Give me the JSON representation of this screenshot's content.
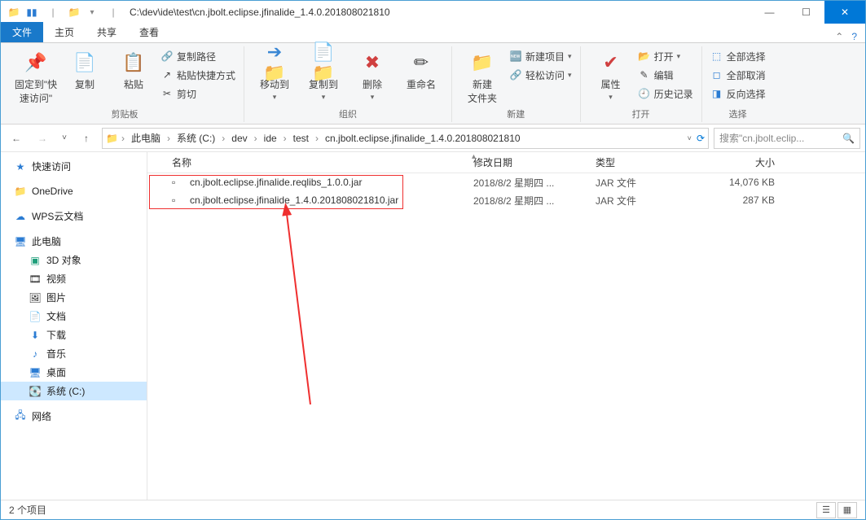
{
  "title_path": "C:\\dev\\ide\\test\\cn.jbolt.eclipse.jfinalide_1.4.0.201808021810",
  "tabs": {
    "file": "文件",
    "home": "主页",
    "share": "共享",
    "view": "查看"
  },
  "ribbon": {
    "pin": {
      "label": "固定到\"快\n速访问\""
    },
    "copy": {
      "label": "复制"
    },
    "paste": {
      "label": "粘贴"
    },
    "clipboard": {
      "copy_path": "复制路径",
      "paste_shortcut": "粘贴快捷方式",
      "cut": "剪切",
      "group": "剪贴板"
    },
    "org": {
      "move_to": "移动到",
      "copy_to": "复制到",
      "delete": "删除",
      "rename": "重命名",
      "group": "组织"
    },
    "new": {
      "new_folder": "新建\n文件夹",
      "new_item": "新建项目",
      "easy_access": "轻松访问",
      "group": "新建"
    },
    "open": {
      "properties": "属性",
      "open": "打开",
      "edit": "编辑",
      "history": "历史记录",
      "group": "打开"
    },
    "select": {
      "select_all": "全部选择",
      "select_none": "全部取消",
      "invert": "反向选择",
      "group": "选择"
    }
  },
  "breadcrumb": [
    "此电脑",
    "系统 (C:)",
    "dev",
    "ide",
    "test",
    "cn.jbolt.eclipse.jfinalide_1.4.0.201808021810"
  ],
  "search_placeholder": "搜索\"cn.jbolt.eclip...",
  "sidebar": {
    "quick": "快速访问",
    "onedrive": "OneDrive",
    "wps": "WPS云文档",
    "thispc": "此电脑",
    "items_pc": [
      "3D 对象",
      "视频",
      "图片",
      "文档",
      "下载",
      "音乐",
      "桌面",
      "系统 (C:)"
    ],
    "network": "网络"
  },
  "columns": {
    "name": "名称",
    "date": "修改日期",
    "type": "类型",
    "size": "大小"
  },
  "files": [
    {
      "name": "cn.jbolt.eclipse.jfinalide.reqlibs_1.0.0.jar",
      "date": "2018/8/2 星期四 ...",
      "type": "JAR 文件",
      "size": "14,076 KB"
    },
    {
      "name": "cn.jbolt.eclipse.jfinalide_1.4.0.201808021810.jar",
      "date": "2018/8/2 星期四 ...",
      "type": "JAR 文件",
      "size": "287 KB"
    }
  ],
  "status": "2 个项目",
  "icons": {
    "folder": "📁",
    "monitor": "🖥",
    "back": "←",
    "fwd": "→",
    "up": "↑",
    "down": "˅",
    "refresh": "⟳",
    "search": "🔍",
    "min": "—",
    "max": "☐",
    "close": "✕",
    "menu_drop": "▾",
    "chev_r": "›",
    "chev_d": "˅",
    "caret": "▴"
  }
}
